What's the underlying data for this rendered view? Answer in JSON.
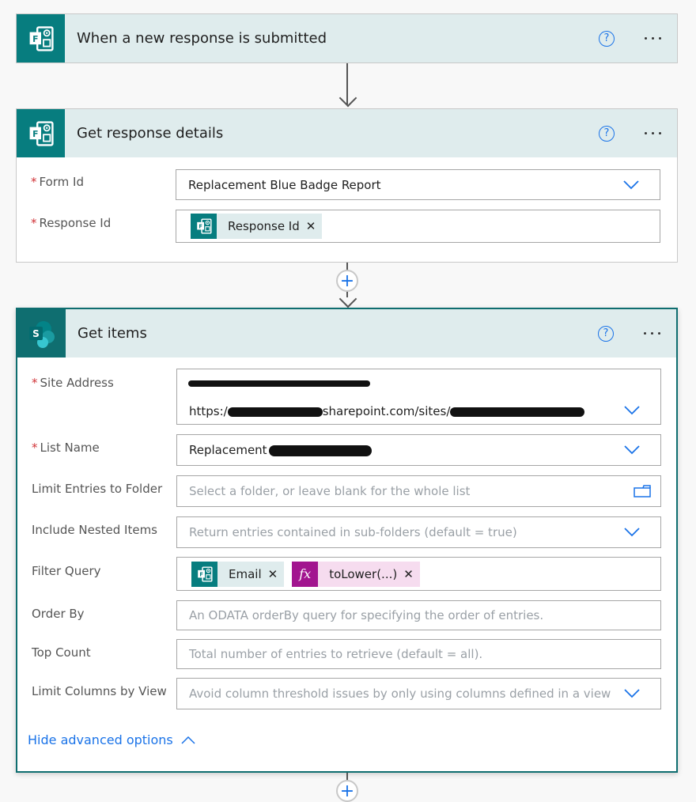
{
  "trigger": {
    "title": "When a new response is submitted",
    "icon": "microsoft-forms-icon",
    "help_icon": "help-circle-icon",
    "more_icon": "more-ellipsis-icon"
  },
  "get_response": {
    "title": "Get response details",
    "icon": "microsoft-forms-icon",
    "fields": {
      "form_id": {
        "label": "Form Id",
        "required": "*",
        "value": "Replacement Blue Badge Report"
      },
      "response_id": {
        "label": "Response Id",
        "required": "*",
        "token": "Response Id",
        "token_remove": "✕"
      }
    }
  },
  "add_step": {
    "symbol": "+"
  },
  "get_items": {
    "title": "Get items",
    "icon": "sharepoint-icon",
    "fields": {
      "site_address": {
        "label": "Site Address",
        "required": "*",
        "value_line1": "[redacted]",
        "value_line2": "https://[redacted].sharepoint.com/sites/[redacted]"
      },
      "list_name": {
        "label": "List Name",
        "required": "*",
        "value": "Replacement [redacted]"
      },
      "limit_folder": {
        "label": "Limit Entries to Folder",
        "placeholder": "Select a folder, or leave blank for the whole list"
      },
      "nested": {
        "label": "Include Nested Items",
        "placeholder": "Return entries contained in sub-folders (default = true)"
      },
      "filter": {
        "label": "Filter Query",
        "tokens": [
          {
            "label": "Email",
            "type": "forms",
            "remove": "✕"
          },
          {
            "label": "toLower(...)",
            "type": "expression",
            "icon_text": "fx",
            "remove": "✕"
          }
        ]
      },
      "order_by": {
        "label": "Order By",
        "placeholder": "An ODATA orderBy query for specifying the order of entries."
      },
      "top_count": {
        "label": "Top Count",
        "placeholder": "Total number of entries to retrieve (default = all)."
      },
      "limit_columns": {
        "label": "Limit Columns by View",
        "placeholder": "Avoid column threshold issues by only using columns defined in a view"
      }
    },
    "advanced_link": "Hide advanced options"
  },
  "colors": {
    "forms_teal": "#077d7f",
    "header_bg": "#dfeced",
    "link_blue": "#1a73e8",
    "fx_magenta": "#a2158f",
    "required_red": "#d13438"
  }
}
